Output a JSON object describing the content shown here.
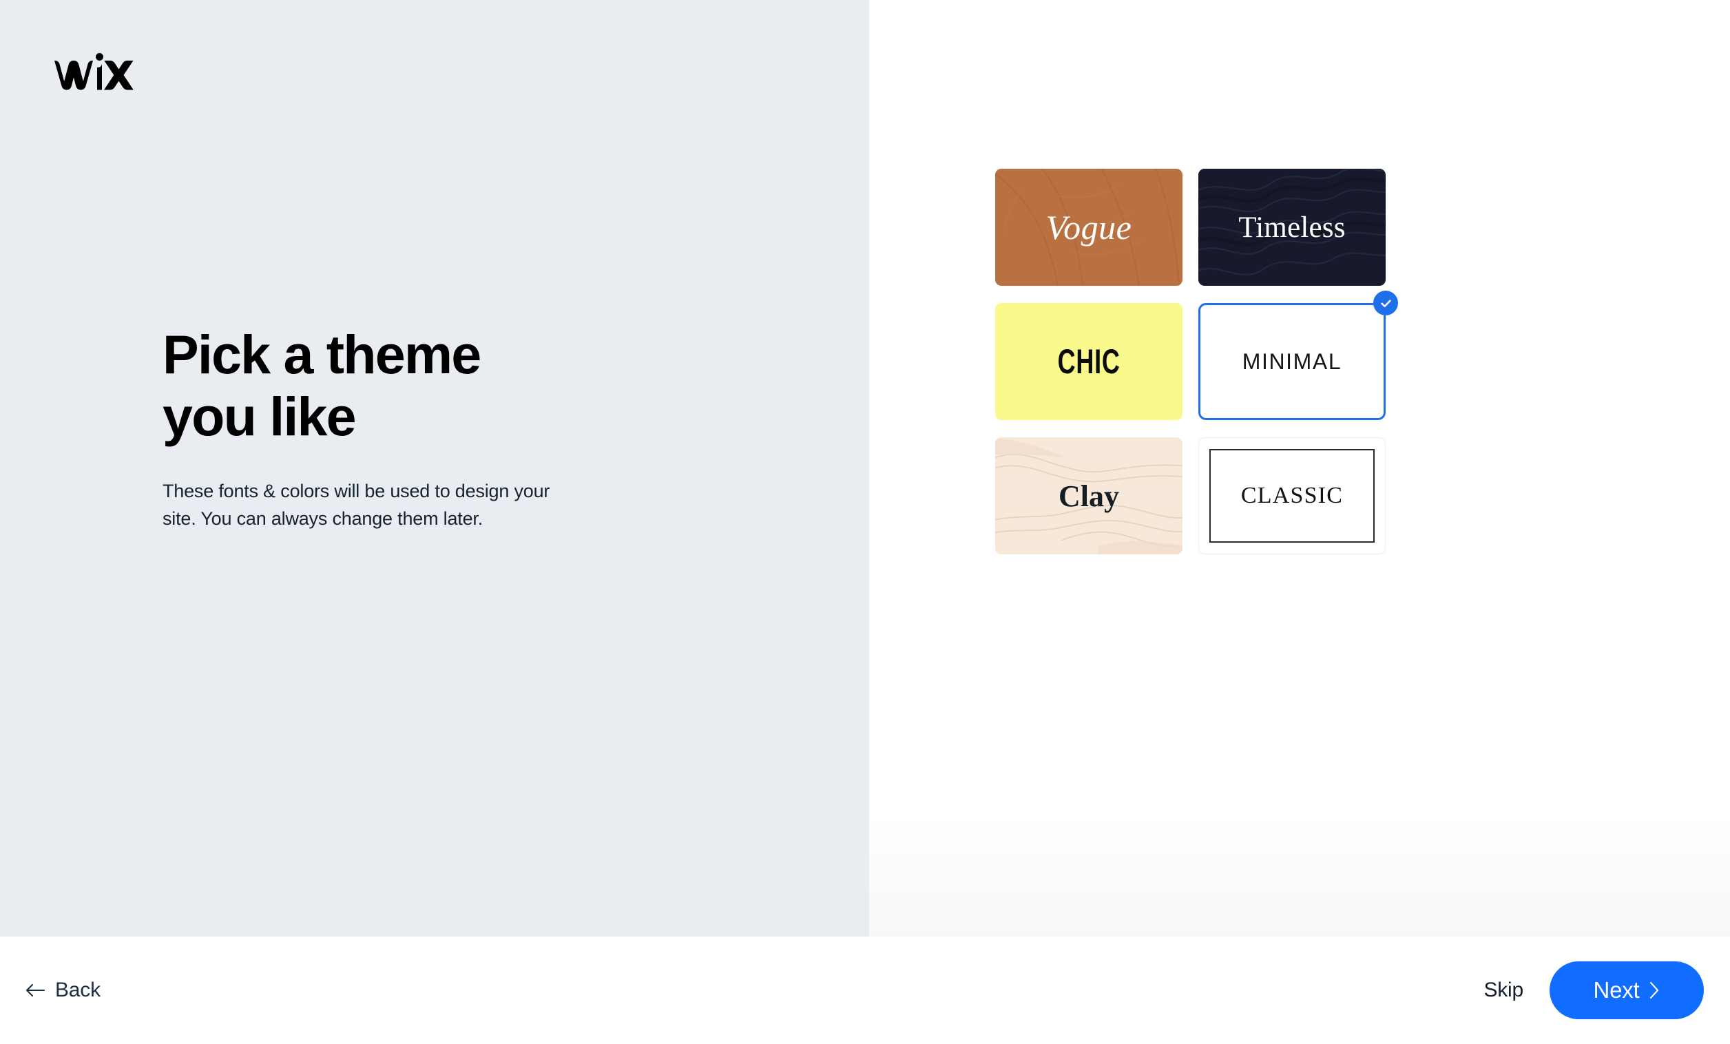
{
  "brand": {
    "name": "WIX",
    "logo_icon": "wix-logo"
  },
  "content": {
    "title": "Pick a theme\nyou like",
    "subtitle": "These fonts & colors will be used to design your\nsite. You can always change them later."
  },
  "themes": {
    "selected": "MINIMAL",
    "selected_badge_icon": "check-icon",
    "items": [
      {
        "label": "Vogue",
        "background_color": "#BA7142",
        "text_color": "#FFFFFF",
        "style": "italic-serif",
        "texture": "leaf-vein",
        "selected": false
      },
      {
        "label": "Timeless",
        "background_color": "#161A2C",
        "text_color": "#FFFFFF",
        "style": "serif",
        "texture": "wave-lines",
        "selected": false
      },
      {
        "label": "CHIC",
        "background_color": "#FAFA8C",
        "text_color": "#0B0B0B",
        "style": "condensed-bold",
        "texture": "none",
        "selected": false
      },
      {
        "label": "MINIMAL",
        "background_color": "#FFFFFF",
        "text_color": "#151515",
        "style": "light-sans",
        "texture": "none",
        "selected": true
      },
      {
        "label": "Clay",
        "background_color": "#F7E8DA",
        "text_color": "#141E22",
        "style": "bold-serif",
        "texture": "plaster",
        "selected": false
      },
      {
        "label": "CLASSIC",
        "background_color": "#FFFFFF",
        "text_color": "#111111",
        "style": "serif-framed",
        "texture": "none",
        "selected": false
      }
    ]
  },
  "footer": {
    "back_label": "Back",
    "back_icon": "arrow-left-icon",
    "skip_label": "Skip",
    "next_label": "Next",
    "next_icon": "chevron-right-icon"
  },
  "colors": {
    "left_panel_bg": "#E9ECF1",
    "right_panel_bg": "#FFFFFF",
    "accent_blue": "#116DFF",
    "selection_blue": "#1F6FEB",
    "text_dark": "#16232F"
  }
}
